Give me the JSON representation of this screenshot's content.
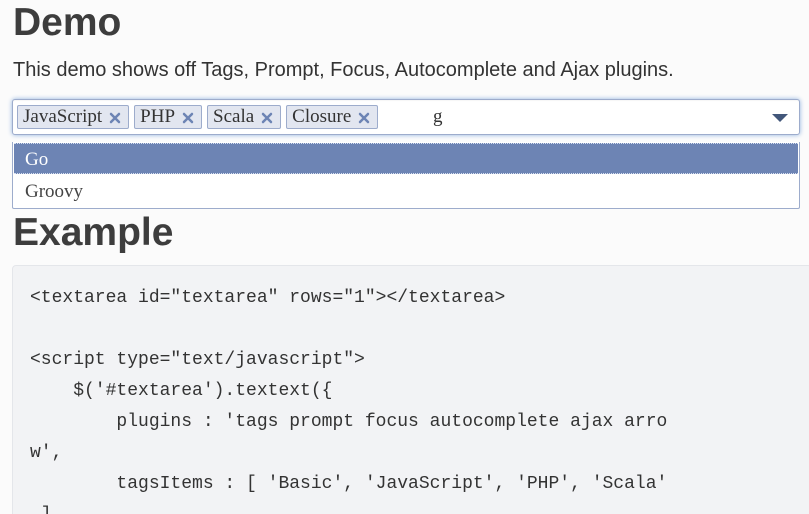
{
  "page": {
    "heading": "Demo",
    "description": "This demo shows off Tags, Prompt, Focus, Autocomplete and Ajax plugins."
  },
  "textext": {
    "tags": [
      {
        "label": "JavaScript"
      },
      {
        "label": "PHP"
      },
      {
        "label": "Scala"
      },
      {
        "label": "Closure"
      }
    ],
    "input_value": "g",
    "remove_icon": "close-icon",
    "dropdown_icon": "triangle-down-icon",
    "focus_glow": "#8fb2de",
    "tag_background": "#e2e6f0"
  },
  "suggestions": {
    "items": [
      {
        "label": "Go",
        "selected": true
      },
      {
        "label": "Groovy",
        "selected": false
      }
    ],
    "selected_background": "#6d84b4"
  },
  "example": {
    "heading": "Example",
    "code_lines": [
      "<textarea id=\"textarea\" rows=\"1\"></textarea>",
      "",
      "<script type=\"text/javascript\">",
      "    $('#textarea').textext({",
      "        plugins : 'tags prompt focus autocomplete ajax arro",
      "w',",
      "        tagsItems : [ 'Basic', 'JavaScript', 'PHP', 'Scala'",
      " ],"
    ]
  }
}
